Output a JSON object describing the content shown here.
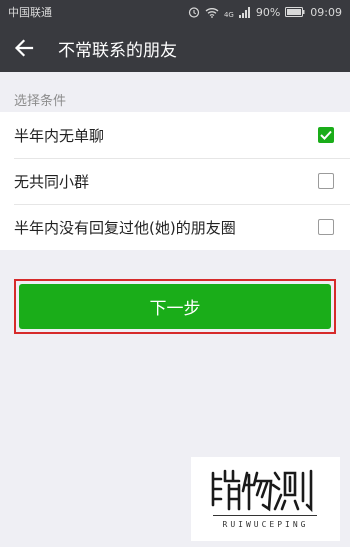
{
  "status_bar": {
    "carrier": "中国联通",
    "network": "4G",
    "battery": "90%",
    "time": "09:09"
  },
  "header": {
    "title": "不常联系的朋友",
    "back_icon": "arrow-left-icon"
  },
  "section": {
    "label": "选择条件"
  },
  "options": [
    {
      "label": "半年内无单聊",
      "checked": true
    },
    {
      "label": "无共同小群",
      "checked": false
    },
    {
      "label": "半年内没有回复过他(她)的朋友圈",
      "checked": false
    }
  ],
  "next_button": {
    "label": "下一步"
  },
  "watermark": {
    "logo": "瑞物测评",
    "caption": "RUIWUCEPING"
  },
  "colors": {
    "accent": "#1aad19",
    "header_bg": "#393a3f",
    "highlight_border": "#d62a2a"
  }
}
